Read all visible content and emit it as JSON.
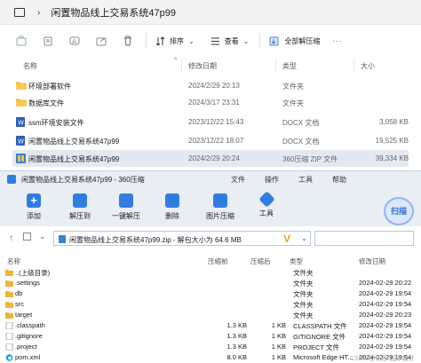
{
  "explorer": {
    "title": "闲置物品线上交易系统47p99",
    "toolbar": {
      "sort_label": "排序",
      "view_label": "查看",
      "extract_all_label": "全部解压缩"
    },
    "columns": {
      "name": "名称",
      "modified": "修改日期",
      "type": "类型",
      "size": "大小"
    },
    "rows": [
      {
        "name": "环境部署软件",
        "modified": "2024/2/29 20:13",
        "type": "文件夹",
        "size": "",
        "icon": "folder-icon"
      },
      {
        "name": "数据库文件",
        "modified": "2024/3/17 23:31",
        "type": "文件夹",
        "size": "",
        "icon": "folder-icon"
      },
      {
        "name": "ssm环境安装文件",
        "modified": "2023/12/22 15:43",
        "type": "DOCX 文档",
        "size": "3,058 KB",
        "icon": "word-doc-icon"
      },
      {
        "name": "闲置物品线上交易系统47p99",
        "modified": "2023/12/22 18:07",
        "type": "DOCX 文档",
        "size": "19,525 KB",
        "icon": "word-doc-icon"
      },
      {
        "name": "闲置物品线上交易系统47p99",
        "modified": "2024/2/29 20:24",
        "type": "360压缩 ZIP 文件",
        "size": "39,334 KB",
        "icon": "zip-archive-icon"
      }
    ]
  },
  "zip": {
    "title": "闲置物品线上交易系统47p99 - 360压缩",
    "menu": [
      "文件",
      "操作",
      "工具",
      "帮助"
    ],
    "tools": [
      "添加",
      "解压到",
      "一键解压",
      "删除",
      "图片压缩",
      "工具"
    ],
    "scan_label": "扫描",
    "path": "闲置物品线上交易系统47p99.zip - 解包大小为 64.6 MB",
    "columns": {
      "name": "名称",
      "compressed": "压缩前",
      "packed": "压缩后",
      "type": "类型",
      "modified": "修改日期"
    },
    "rows": [
      {
        "name": "..(上级目录)",
        "compressed": "",
        "packed": "",
        "type": "文件夹",
        "modified": ""
      },
      {
        "name": ".settings",
        "compressed": "",
        "packed": "",
        "type": "文件夹",
        "modified": "2024-02-29 20:22"
      },
      {
        "name": "db",
        "compressed": "",
        "packed": "",
        "type": "文件夹",
        "modified": "2024-02-29 19:54"
      },
      {
        "name": "src",
        "compressed": "",
        "packed": "",
        "type": "文件夹",
        "modified": "2024-02-29 19:54"
      },
      {
        "name": "target",
        "compressed": "",
        "packed": "",
        "type": "文件夹",
        "modified": "2024-02-29 20:23"
      },
      {
        "name": ".classpath",
        "compressed": "1.3 KB",
        "packed": "1 KB",
        "type": "CLASSPATH 文件",
        "modified": "2024-02-29 19:54"
      },
      {
        "name": ".gitignore",
        "compressed": "1.3 KB",
        "packed": "1 KB",
        "type": "GITIGNORE 文件",
        "modified": "2024-02-29 19:54"
      },
      {
        "name": ".project",
        "compressed": "1.3 KB",
        "packed": "1 KB",
        "type": "PROJECT 文件",
        "modified": "2024-02-29 19:54"
      },
      {
        "name": "pom.xml",
        "compressed": "8.0 KB",
        "packed": "1 KB",
        "type": "Microsoft Edge HT...",
        "modified": "2024-02-29 19:54"
      }
    ]
  },
  "watermark": "CSDN @乐乐 程序设计",
  "colors": {
    "accent": "#2f7de1",
    "folder": "#f0b43c",
    "selected_row": "#e4e9f1"
  }
}
